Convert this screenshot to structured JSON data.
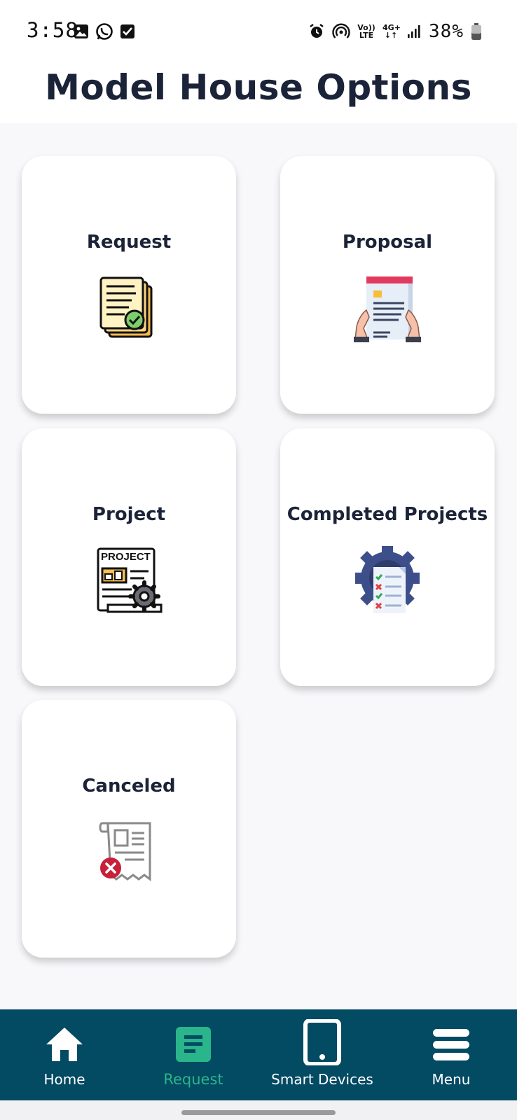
{
  "status_bar": {
    "time": "3:58",
    "battery_percent": "38%",
    "network_label_top": "Vo))",
    "network_label_bottom": "LTE",
    "data_label": "4G+"
  },
  "header": {
    "title": "Model House Options"
  },
  "cards": [
    {
      "label": "Request",
      "icon": "documents-check-icon"
    },
    {
      "label": "Proposal",
      "icon": "hands-holding-document-icon"
    },
    {
      "label": "Project",
      "icon": "project-document-gear-icon"
    },
    {
      "label": "Completed Projects",
      "icon": "gear-checklist-icon"
    },
    {
      "label": "Canceled",
      "icon": "receipt-canceled-icon"
    }
  ],
  "project_icon_text": "PROJECT",
  "bottom_nav": {
    "items": [
      {
        "label": "Home",
        "icon": "home-icon",
        "active": false
      },
      {
        "label": "Request",
        "icon": "request-list-icon",
        "active": true
      },
      {
        "label": "Smart Devices",
        "icon": "tablet-icon",
        "active": false
      },
      {
        "label": "Menu",
        "icon": "menu-icon",
        "active": false
      }
    ],
    "background": "#034a63",
    "active_color": "#2ab58a"
  }
}
